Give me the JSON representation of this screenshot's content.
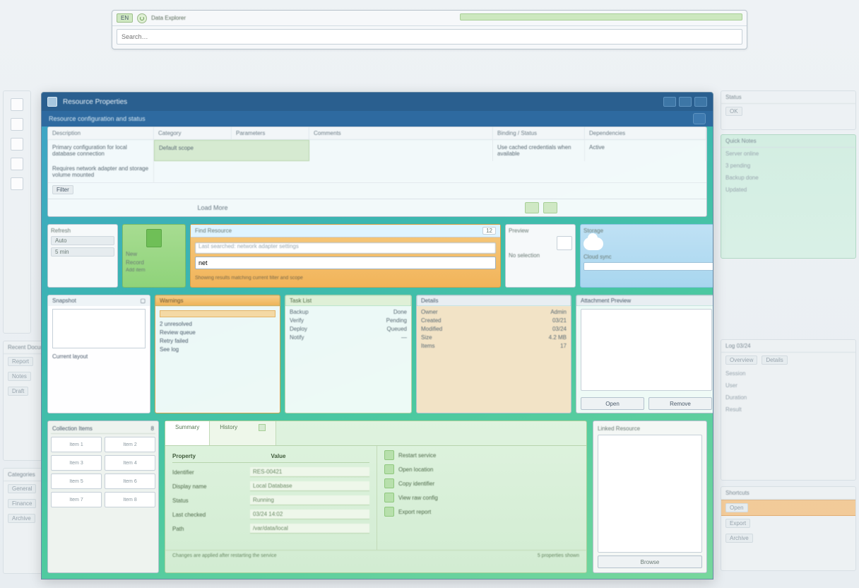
{
  "top_bar": {
    "badge": "EN",
    "title": "Data Explorer",
    "address_placeholder": "Search…"
  },
  "background": {
    "left_panel2_title": "Recent Documents",
    "left_panel2_items": [
      "Report",
      "Notes",
      "Draft"
    ],
    "left_panel3_title": "Categories",
    "left_panel3_items": [
      "General",
      "Finance",
      "Archive"
    ],
    "right_a_title": "Status",
    "right_b_title": "Quick Notes",
    "right_b_items": [
      "Server online",
      "3 pending",
      "Backup done",
      "Updated"
    ],
    "right_c_title": "Log 03/24",
    "right_c_tabs": [
      "Overview",
      "Details"
    ],
    "right_c_rows": [
      "Session",
      "User",
      "Duration",
      "Result"
    ],
    "right_d_title": "Shortcuts",
    "right_d_rows": [
      "Open",
      "Export",
      "Archive"
    ]
  },
  "main_window": {
    "title": "Resource Properties",
    "subtitle": "Resource configuration and status"
  },
  "top_table": {
    "headers": [
      "Description",
      "Category",
      "Parameters",
      "Comments",
      "Binding / Status",
      "Dependencies"
    ],
    "row": {
      "desc": "Primary configuration for local database connection",
      "group": "Default scope",
      "comments": "Use cached credentials when available",
      "status": "Active",
      "deps": "Requires network adapter and storage volume mounted"
    },
    "footer_label": "Load More",
    "chip": "Filter"
  },
  "mid": {
    "col1_label": "Refresh",
    "col1_rows": [
      "Auto",
      "5 min"
    ],
    "green_label1": "New",
    "green_label2": "Record",
    "green_label3": "Add item",
    "search_title": "Find Resource",
    "search_badge": "12",
    "search_value": "net",
    "search_line": "Last searched: network adapter settings",
    "search_foot": "Showing results matching current filter and scope",
    "plain_label1": "Preview",
    "plain_label2": "No selection",
    "blue_label1": "Storage",
    "blue_label2": "Cloud sync"
  },
  "panels": {
    "a_title": "Snapshot",
    "a_caption": "Current layout",
    "b_title": "Warnings",
    "b_rows": [
      "2 unresolved",
      "Review queue",
      "Retry failed",
      "See log"
    ],
    "c_title": "Task List",
    "c_rows": [
      [
        "Backup",
        "Done"
      ],
      [
        "Verify",
        "Pending"
      ],
      [
        "Deploy",
        "Queued"
      ],
      [
        "Notify",
        "—"
      ]
    ],
    "d_title": "Details",
    "d_rows": [
      [
        "Owner",
        "Admin"
      ],
      [
        "Created",
        "03/21"
      ],
      [
        "Modified",
        "03/24"
      ],
      [
        "Size",
        "4.2 MB"
      ],
      [
        "Items",
        "17"
      ]
    ],
    "e_title": "Attachment Preview",
    "e_btn1": "Open",
    "e_btn2": "Remove"
  },
  "bottom": {
    "left_title": "Collection Items",
    "left_cells": [
      "Item 1",
      "Item 2",
      "Item 3",
      "Item 4",
      "Item 5",
      "Item 6",
      "Item 7",
      "Item 8"
    ],
    "tab1": "Summary",
    "tab2": "History",
    "head1": "Property",
    "head2": "Value",
    "fields": [
      [
        "Identifier",
        "RES-00421"
      ],
      [
        "Display name",
        "Local Database"
      ],
      [
        "Status",
        "Running"
      ],
      [
        "Last checked",
        "03/24 14:02"
      ],
      [
        "Path",
        "/var/data/local"
      ]
    ],
    "side_items": [
      "Restart service",
      "Open location",
      "Copy identifier",
      "View raw config",
      "Export report"
    ],
    "foot_left": "Changes are applied after restarting the service",
    "foot_right": "5 properties shown",
    "right_title": "Linked Resource",
    "right_btn": "Browse"
  }
}
